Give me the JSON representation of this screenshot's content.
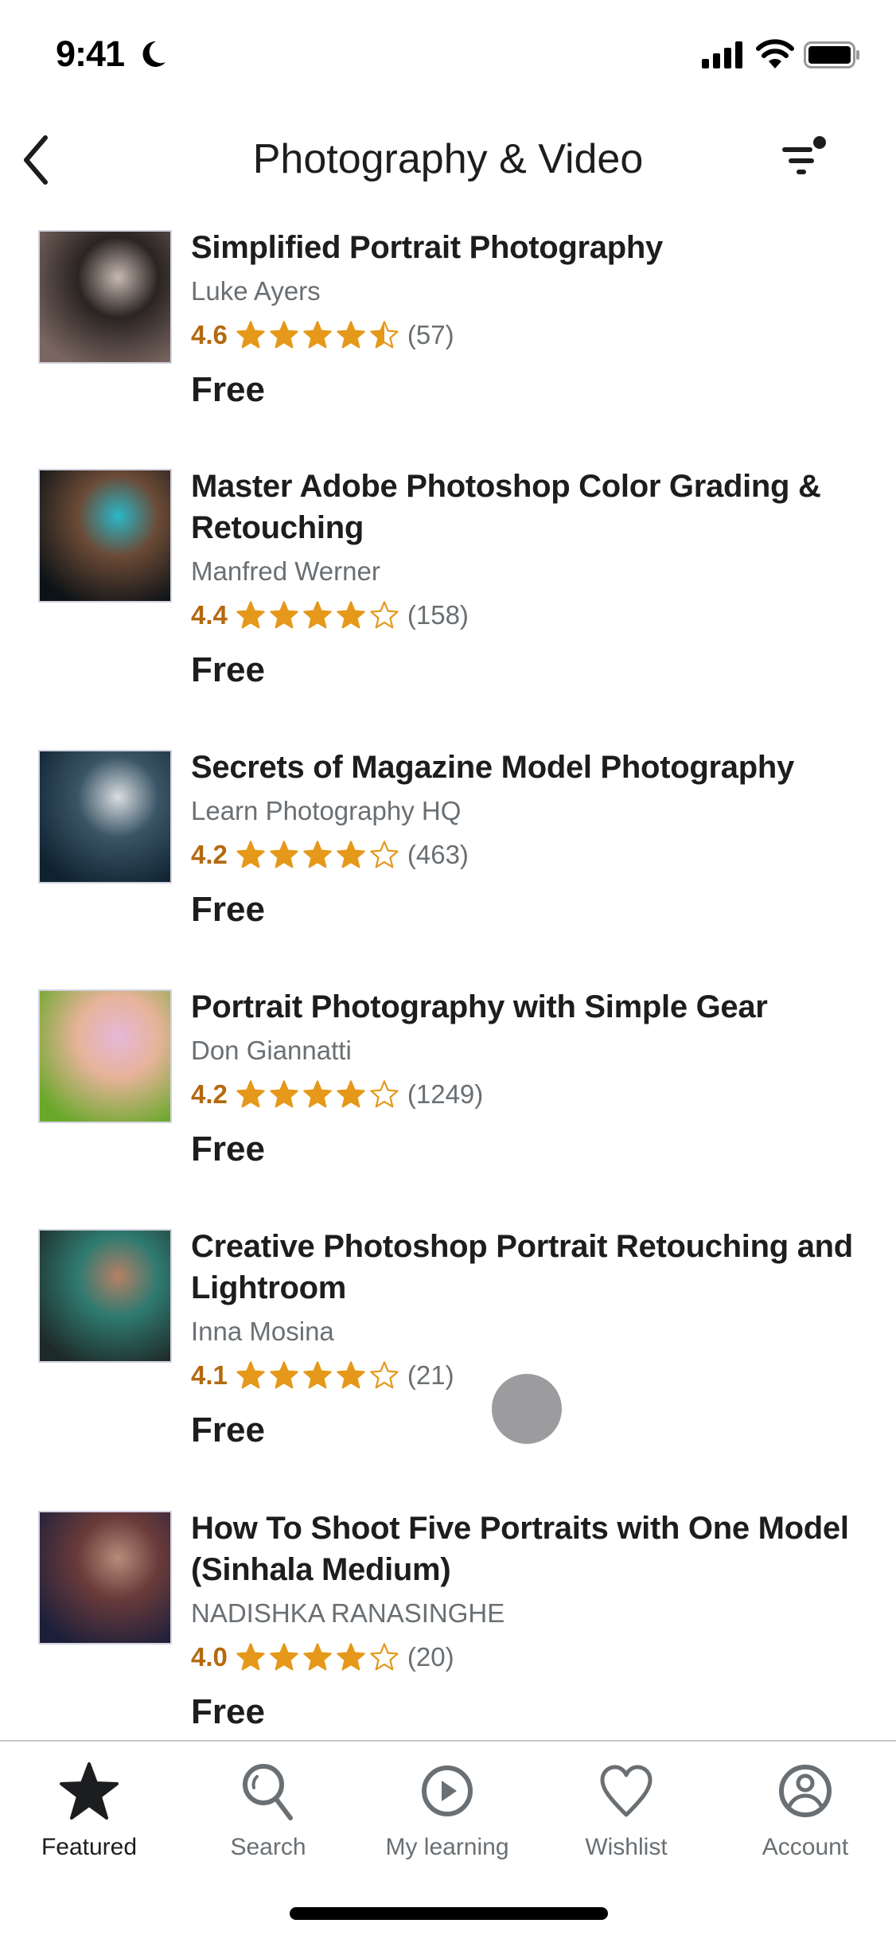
{
  "status_bar": {
    "time": "9:41",
    "focus_icon": "moon-icon",
    "signal_icon": "cellular-signal-icon",
    "wifi_icon": "wifi-icon",
    "battery_icon": "battery-icon"
  },
  "nav": {
    "back_icon": "chevron-left-icon",
    "title": "Photography & Video",
    "filter_icon": "filter-icon"
  },
  "colors": {
    "rating": "#b4690e",
    "star": "#e59819",
    "text_primary": "#1c1d1f",
    "text_secondary": "#6a6f73"
  },
  "courses": [
    {
      "title": "Simplified Portrait Photography",
      "author": "Luke Ayers",
      "rating": "4.6",
      "rating_value": 4.6,
      "reviews": "(57)",
      "price": "Free",
      "thumb_colors": [
        "#7a6660",
        "#2a2422",
        "#c6b8b0"
      ]
    },
    {
      "title": "Master Adobe Photoshop Color Grading & Retouching",
      "author": "Manfred Werner",
      "rating": "4.4",
      "rating_value": 4.4,
      "reviews": "(158)",
      "price": "Free",
      "thumb_colors": [
        "#0c1216",
        "#6b4a36",
        "#2ab6c8"
      ]
    },
    {
      "title": "Secrets of Magazine Model Photography",
      "author": "Learn Photography HQ",
      "rating": "4.2",
      "rating_value": 4.2,
      "reviews": "(463)",
      "price": "Free",
      "thumb_colors": [
        "#0f2230",
        "#3a5566",
        "#d9dde0"
      ]
    },
    {
      "title": "Portrait Photography with Simple Gear",
      "author": "Don Giannatti",
      "rating": "4.2",
      "rating_value": 4.2,
      "reviews": "(1249)",
      "price": "Free",
      "thumb_colors": [
        "#6aa82a",
        "#e7b39a",
        "#e5b8d8"
      ]
    },
    {
      "title": "Creative Photoshop Portrait Retouching and Lightroom",
      "author": "Inna Mosina",
      "rating": "4.1",
      "rating_value": 4.1,
      "reviews": "(21)",
      "price": "Free",
      "thumb_colors": [
        "#1e2a28",
        "#2f7a70",
        "#b58066"
      ]
    },
    {
      "title": "How To Shoot Five Portraits with One Model (Sinhala Medium)",
      "author": "NADISHKA RANASINGHE",
      "rating": "4.0",
      "rating_value": 4.0,
      "reviews": "(20)",
      "price": "Free",
      "thumb_colors": [
        "#1d1f3a",
        "#6a3b3a",
        "#b78c7a"
      ]
    }
  ],
  "tab_bar": {
    "tabs": [
      {
        "label": "Featured",
        "icon": "star-icon",
        "active": true
      },
      {
        "label": "Search",
        "icon": "search-icon",
        "active": false
      },
      {
        "label": "My learning",
        "icon": "play-circle-icon",
        "active": false
      },
      {
        "label": "Wishlist",
        "icon": "heart-icon",
        "active": false
      },
      {
        "label": "Account",
        "icon": "account-circle-icon",
        "active": false
      }
    ]
  }
}
